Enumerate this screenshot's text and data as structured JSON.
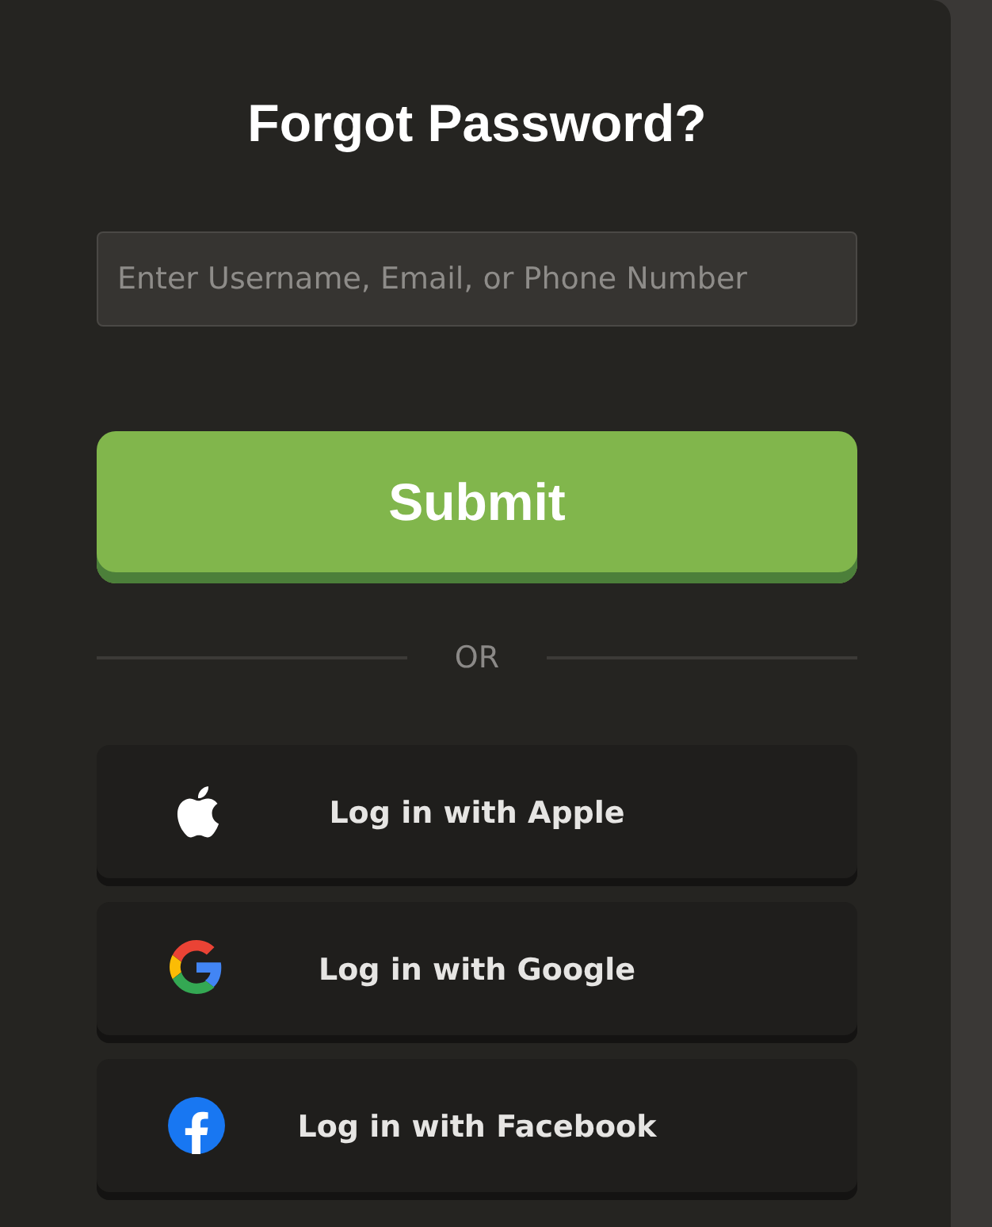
{
  "title": "Forgot Password?",
  "search": {
    "placeholder": "Enter Username, Email, or Phone Number"
  },
  "submit": {
    "label": "Submit"
  },
  "divider": {
    "label": "OR"
  },
  "social_buttons": [
    {
      "kind": "apple",
      "label": "Log in with Apple"
    },
    {
      "kind": "google",
      "label": "Log in with Google"
    },
    {
      "kind": "facebook",
      "label": "Log in with Facebook"
    }
  ]
}
